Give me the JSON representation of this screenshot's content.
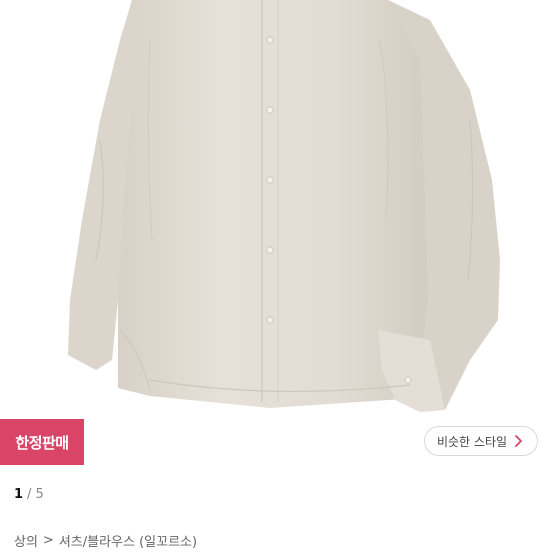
{
  "badge": {
    "label": "한정판매"
  },
  "similar_style": {
    "label": "비슷한 스타일",
    "icon": "chevron-right-icon"
  },
  "pager": {
    "current": "1",
    "separator": "/",
    "total": "5"
  },
  "breadcrumb": {
    "items": [
      "상의",
      "셔츠/블라우스 (일꼬르소)"
    ],
    "separator": ">"
  },
  "colors": {
    "badge": "#d94467",
    "shirt": "#e2dcd4"
  }
}
